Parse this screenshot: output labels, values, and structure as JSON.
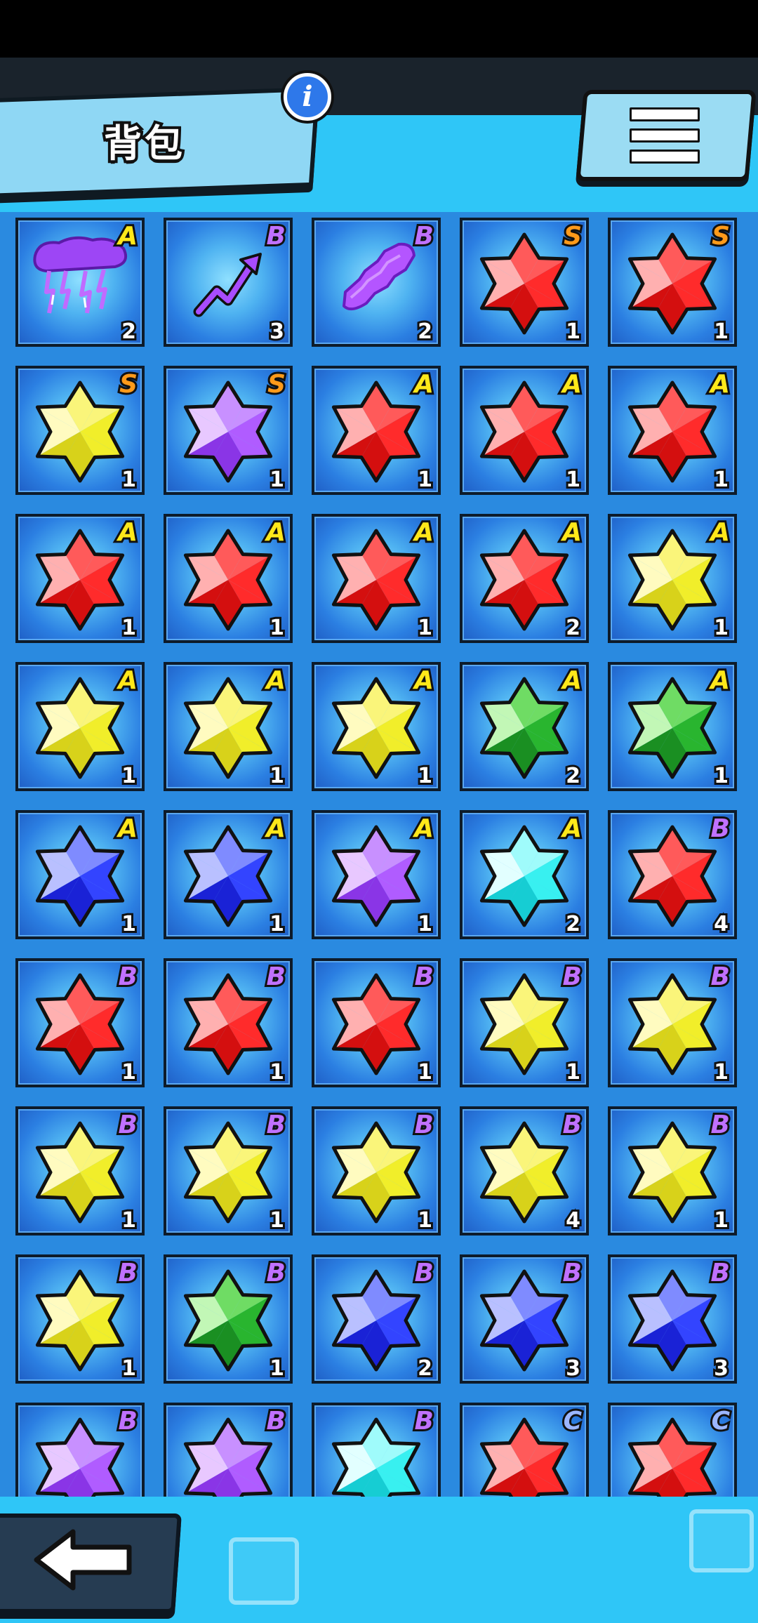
{
  "header": {
    "title": "背包",
    "info_label": "i"
  },
  "colors": {
    "grade_A": "#ffe81a",
    "grade_S": "#ff9a1a",
    "grade_B": "#c071ff",
    "grade_C": "#9bb6ff",
    "red": "#ff2b2b",
    "yellow": "#f1ee2a",
    "purple": "#b05cff",
    "blue": "#3344ff",
    "green": "#29b52f",
    "cyan": "#38f0f0"
  },
  "inventory": [
    {
      "item": "lightning",
      "grade": "A",
      "count": "2"
    },
    {
      "item": "arrow",
      "grade": "B",
      "count": "3"
    },
    {
      "item": "steps",
      "grade": "B",
      "count": "2"
    },
    {
      "item": "red",
      "grade": "S",
      "count": "1"
    },
    {
      "item": "red",
      "grade": "S",
      "count": "1"
    },
    {
      "item": "yellow",
      "grade": "S",
      "count": "1"
    },
    {
      "item": "purple",
      "grade": "S",
      "count": "1"
    },
    {
      "item": "red",
      "grade": "A",
      "count": "1"
    },
    {
      "item": "red",
      "grade": "A",
      "count": "1"
    },
    {
      "item": "red",
      "grade": "A",
      "count": "1"
    },
    {
      "item": "red",
      "grade": "A",
      "count": "1"
    },
    {
      "item": "red",
      "grade": "A",
      "count": "1"
    },
    {
      "item": "red",
      "grade": "A",
      "count": "1"
    },
    {
      "item": "red",
      "grade": "A",
      "count": "2"
    },
    {
      "item": "yellow",
      "grade": "A",
      "count": "1"
    },
    {
      "item": "yellow",
      "grade": "A",
      "count": "1"
    },
    {
      "item": "yellow",
      "grade": "A",
      "count": "1"
    },
    {
      "item": "yellow",
      "grade": "A",
      "count": "1"
    },
    {
      "item": "green",
      "grade": "A",
      "count": "2"
    },
    {
      "item": "green",
      "grade": "A",
      "count": "1"
    },
    {
      "item": "blue",
      "grade": "A",
      "count": "1"
    },
    {
      "item": "blue",
      "grade": "A",
      "count": "1"
    },
    {
      "item": "purple",
      "grade": "A",
      "count": "1"
    },
    {
      "item": "cyan",
      "grade": "A",
      "count": "2"
    },
    {
      "item": "red",
      "grade": "B",
      "count": "4"
    },
    {
      "item": "red",
      "grade": "B",
      "count": "1"
    },
    {
      "item": "red",
      "grade": "B",
      "count": "1"
    },
    {
      "item": "red",
      "grade": "B",
      "count": "1"
    },
    {
      "item": "yellow",
      "grade": "B",
      "count": "1"
    },
    {
      "item": "yellow",
      "grade": "B",
      "count": "1"
    },
    {
      "item": "yellow",
      "grade": "B",
      "count": "1"
    },
    {
      "item": "yellow",
      "grade": "B",
      "count": "1"
    },
    {
      "item": "yellow",
      "grade": "B",
      "count": "1"
    },
    {
      "item": "yellow",
      "grade": "B",
      "count": "4"
    },
    {
      "item": "yellow",
      "grade": "B",
      "count": "1"
    },
    {
      "item": "yellow",
      "grade": "B",
      "count": "1"
    },
    {
      "item": "green",
      "grade": "B",
      "count": "1"
    },
    {
      "item": "blue",
      "grade": "B",
      "count": "2"
    },
    {
      "item": "blue",
      "grade": "B",
      "count": "3"
    },
    {
      "item": "blue",
      "grade": "B",
      "count": "3"
    },
    {
      "item": "purple",
      "grade": "B",
      "count": ""
    },
    {
      "item": "purple",
      "grade": "B",
      "count": ""
    },
    {
      "item": "cyan",
      "grade": "B",
      "count": ""
    },
    {
      "item": "red",
      "grade": "C",
      "count": ""
    },
    {
      "item": "red",
      "grade": "C",
      "count": ""
    }
  ]
}
